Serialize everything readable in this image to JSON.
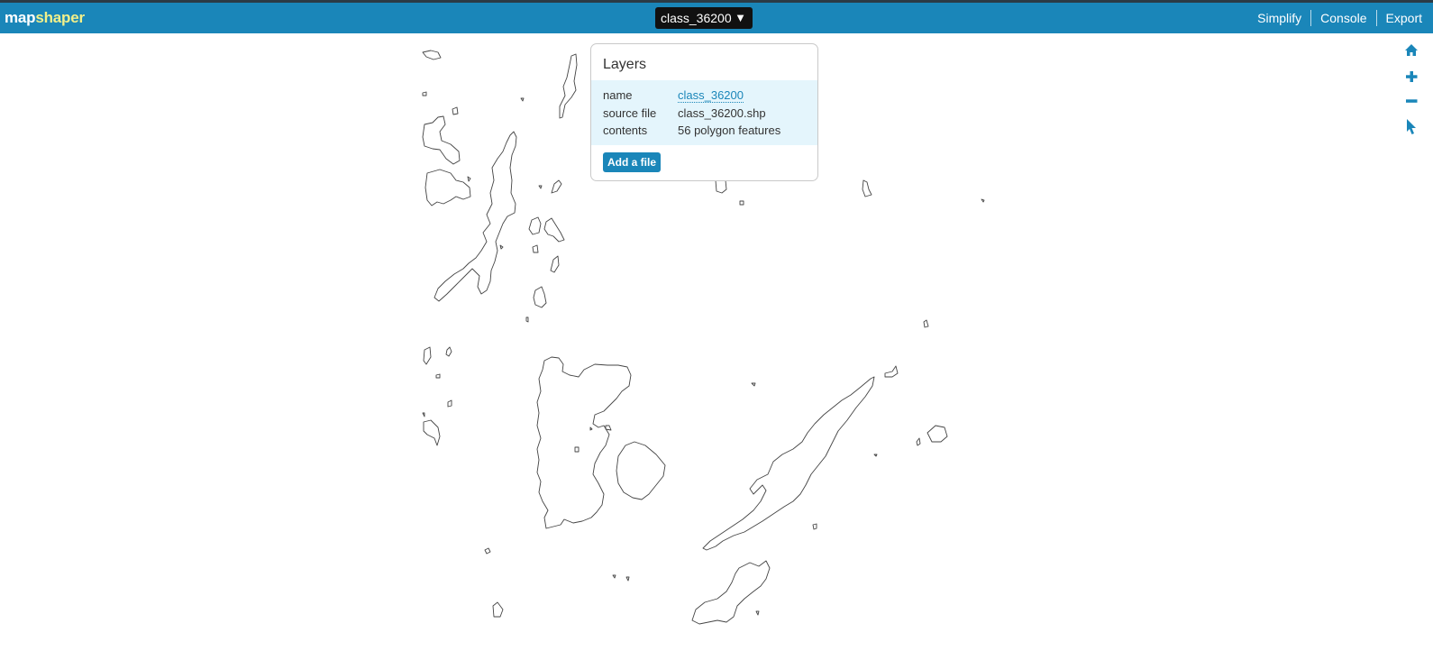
{
  "app": {
    "logo_part1": "map",
    "logo_part2": "shaper",
    "logo_colors": {
      "part1": "#ffffff",
      "part2": "#f2f08a"
    },
    "topbar_color": "#1a86b9"
  },
  "layer_selector": {
    "value": "class_36200",
    "caret": "▼"
  },
  "menu": {
    "simplify": "Simplify",
    "console": "Console",
    "export": "Export"
  },
  "tools": [
    {
      "name": "home-icon",
      "icon": "home"
    },
    {
      "name": "zoom-in-icon",
      "icon": "plus"
    },
    {
      "name": "zoom-out-icon",
      "icon": "minus"
    },
    {
      "name": "select-pointer-icon",
      "icon": "pointer"
    }
  ],
  "layers_panel": {
    "title": "Layers",
    "rows": [
      {
        "key": "name",
        "value": "class_36200"
      },
      {
        "key": "source file",
        "value": "class_36200.shp"
      },
      {
        "key": "contents",
        "value": "56 polygon features"
      }
    ],
    "add_file_label": "Add a file"
  },
  "map": {
    "stroke_color": "#444444",
    "feature_count": 56
  }
}
